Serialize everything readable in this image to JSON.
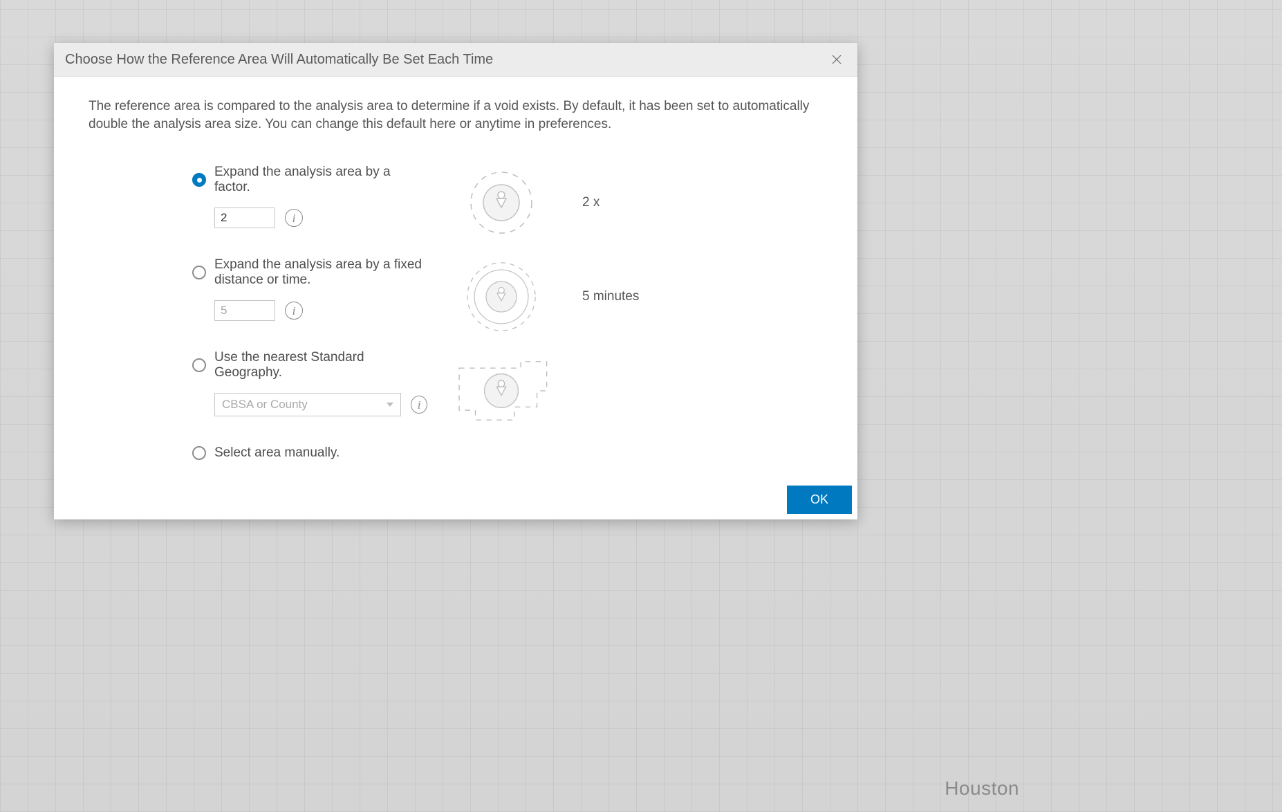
{
  "map": {
    "city_label": "Houston"
  },
  "modal": {
    "title": "Choose How the Reference Area Will Automatically Be Set Each Time",
    "intro": "The reference area is compared to the analysis area to determine if a void exists. By default, it has been set to automatically double the analysis area size. You can change this default here or anytime in preferences.",
    "options": {
      "factor": {
        "label": "Expand the analysis area by a factor.",
        "value": "2",
        "selected": true,
        "illus_label": "2 x"
      },
      "distance": {
        "label": "Expand the analysis area by a fixed distance or time.",
        "value": "5",
        "selected": false,
        "illus_label": "5 minutes"
      },
      "geography": {
        "label": "Use the nearest Standard Geography.",
        "placeholder": "CBSA or County",
        "selected": false
      },
      "manual": {
        "label": "Select area manually.",
        "selected": false
      }
    },
    "buttons": {
      "ok": "OK"
    },
    "info_glyph": "i"
  }
}
